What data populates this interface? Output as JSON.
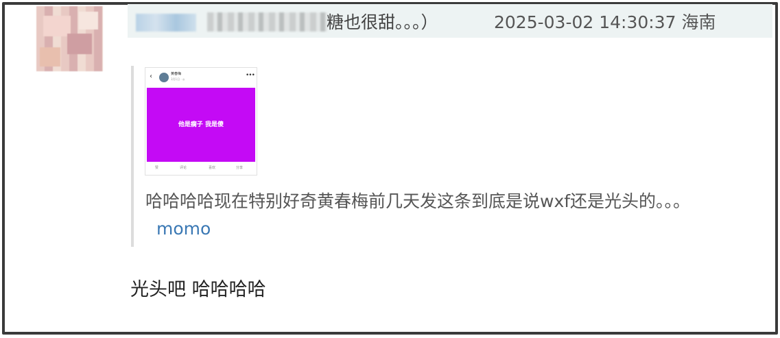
{
  "comment": {
    "header_text": "糖也很甜。。。）",
    "timestamp": "2025-03-02 14:30:37 海南",
    "quote": {
      "embed": {
        "back_icon": "back-chevron-icon",
        "account_name": "黄春梅",
        "account_meta": "3月1日 · ◎",
        "more_icon": "more-dots-icon",
        "image_text": "他是瘸子 我是傻",
        "image_color": "#c40af5",
        "actions": [
          "赞",
          "评论",
          "喜欢",
          "分享"
        ]
      },
      "text": "哈哈哈哈现在特别好奇黄春梅前几天发这条到底是说wxf还是光头的。。。",
      "author_link": "momo"
    },
    "reply_text": "光头吧 哈哈哈哈"
  }
}
